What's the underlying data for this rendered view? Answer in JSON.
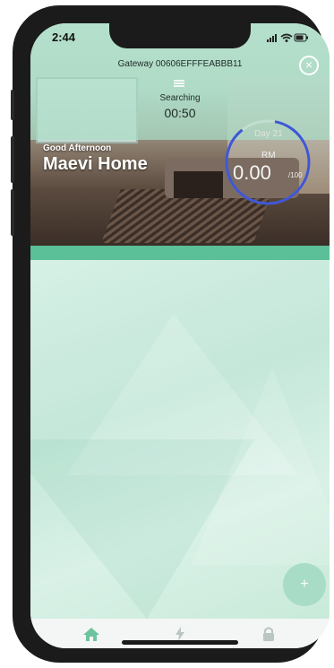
{
  "status_bar": {
    "time": "2:44"
  },
  "header": {
    "gateway": "Gateway 00606EFFFEABBB11",
    "search_status": "Searching",
    "countdown": "00:50"
  },
  "home": {
    "greeting": "Good Afternoon",
    "name": "Maevi Home"
  },
  "usage": {
    "day": "Day 21",
    "currency": "RM",
    "amount": "0.00",
    "max": "/100"
  },
  "colors": {
    "accent": "#5bbf98",
    "ring": "#3f57d6",
    "fab": "#a8dcc6"
  },
  "icons": [
    "close-icon",
    "wifi-icon",
    "battery-icon",
    "signal-icon",
    "home-icon",
    "bolt-icon",
    "lock-icon",
    "plus-icon"
  ],
  "fab_label": "+"
}
